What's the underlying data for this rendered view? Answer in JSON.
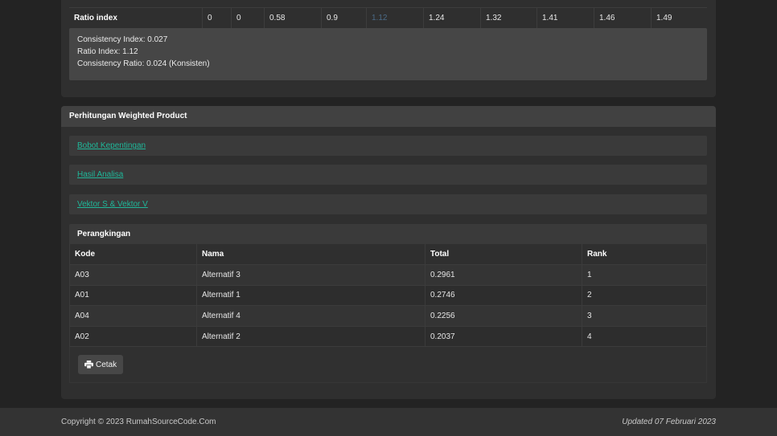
{
  "ratio_index": {
    "label": "Ratio index",
    "values": [
      "0",
      "0",
      "0.58",
      "0.9",
      "1.12",
      "1.24",
      "1.32",
      "1.41",
      "1.46",
      "1.49"
    ],
    "highlight_index": 4
  },
  "consistency": {
    "ci": "Consistency Index: 0.027",
    "ri": "Ratio Index: 1.12",
    "cr": "Consistency Ratio: 0.024 (Konsisten)"
  },
  "weighted_product": {
    "title": "Perhitungan Weighted Product",
    "links": [
      "Bobot Kepentingan",
      "Hasil Analisa",
      "Vektor S & Vektor V"
    ],
    "ranking": {
      "title": "Perangkingan",
      "columns": [
        "Kode",
        "Nama",
        "Total",
        "Rank"
      ],
      "rows": [
        [
          "A03",
          "Alternatif 3",
          "0.2961",
          "1"
        ],
        [
          "A01",
          "Alternatif 1",
          "0.2746",
          "2"
        ],
        [
          "A04",
          "Alternatif 4",
          "0.2256",
          "3"
        ],
        [
          "A02",
          "Alternatif 2",
          "0.2037",
          "4"
        ]
      ]
    },
    "print_label": "Cetak",
    "print_icon": "printer-icon"
  },
  "footer": {
    "copyright": "Copyright © 2023 RumahSourceCode.Com",
    "updated": "Updated 07 Februari 2023"
  },
  "colors": {
    "link": "#1fb89a",
    "highlight_value": "#4a6a87",
    "background": "#232323",
    "panel": "#2f2f2f"
  }
}
